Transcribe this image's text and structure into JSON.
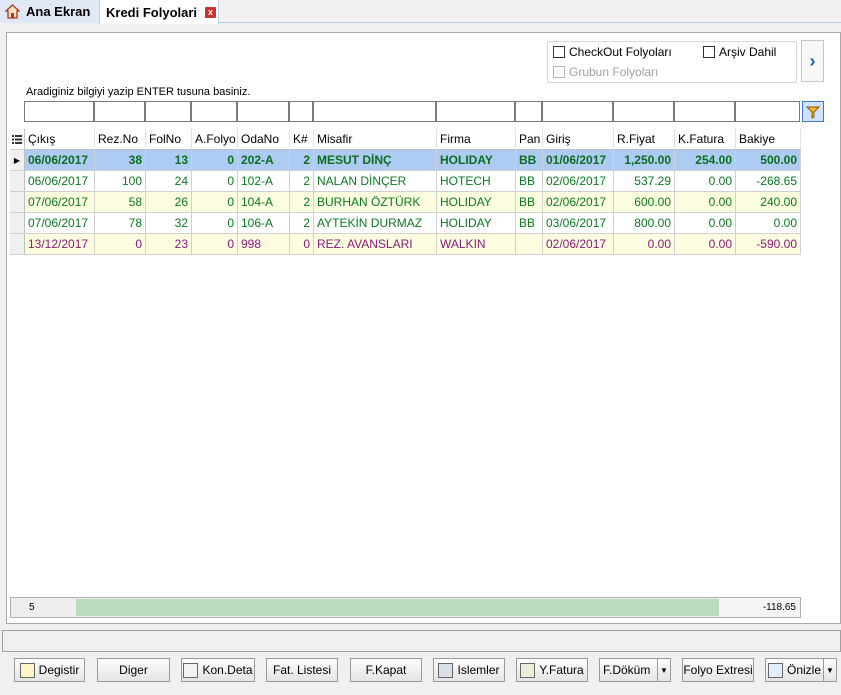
{
  "tabs": {
    "home": "Ana Ekran",
    "active": "Kredi Folyolari",
    "close": "x"
  },
  "options": {
    "checkout": "CheckOut Folyoları",
    "arsiv": "Arşiv Dahil",
    "grubun": "Grubun Folyoları",
    "next": "›"
  },
  "search_label": "Aradiginiz bilgiyi yazip ENTER tusuna basiniz.",
  "grid": {
    "columns": [
      "Çıkış",
      "Rez.No",
      "FolNo",
      "A.Folyo",
      "OdaNo",
      "K#",
      "Misafir",
      "Firma",
      "Pan",
      "Giriş",
      "R.Fiyat",
      "K.Fatura",
      "Bakiye"
    ],
    "rows": [
      [
        "06/06/2017",
        "38",
        "13",
        "0",
        "202-A",
        "2",
        "MESUT DİNÇ",
        "HOLIDAY",
        "BB",
        "01/06/2017",
        "1,250.00",
        "254.00",
        "500.00"
      ],
      [
        "06/06/2017",
        "100",
        "24",
        "0",
        "102-A",
        "2",
        "NALAN DİNÇER",
        "HOTECH",
        "BB",
        "02/06/2017",
        "537.29",
        "0.00",
        "-268.65"
      ],
      [
        "07/06/2017",
        "58",
        "26",
        "0",
        "104-A",
        "2",
        "BURHAN ÖZTÜRK",
        "HOLIDAY",
        "BB",
        "02/06/2017",
        "600.00",
        "0.00",
        "240.00"
      ],
      [
        "07/06/2017",
        "78",
        "32",
        "0",
        "106-A",
        "2",
        "AYTEKİN DURMAZ",
        "HOLIDAY",
        "BB",
        "03/06/2017",
        "800.00",
        "0.00",
        "0.00"
      ],
      [
        "13/12/2017",
        "0",
        "23",
        "0",
        "998",
        "0",
        "REZ. AVANSLARI",
        "WALKIN",
        "",
        "02/06/2017",
        "0.00",
        "0.00",
        "-590.00"
      ]
    ],
    "row_styles": [
      "row-sel",
      "row-g",
      "row-y",
      "row-g",
      "row-p"
    ],
    "row_backgrounds": [
      "#aecbf3",
      "#ffffff",
      "#fdfde0",
      "#ffffff",
      "#fdfde0"
    ]
  },
  "summary": {
    "count": "5",
    "total": "-118.65"
  },
  "buttons": {
    "degistir": "Degistir",
    "diger": "Diger",
    "kondeta": "Kon.Deta",
    "fatlistesi": "Fat. Listesi",
    "fkapat": "F.Kapat",
    "islemler": "Islemler",
    "yfatura": "Y.Fatura",
    "fdokum": "F.Döküm",
    "folyoextresi": "Folyo Extresi",
    "onizle": "Önizle"
  },
  "colors": {
    "selected_row": "#aecbf3",
    "green_text": "#0a7a1e",
    "purple_text": "#8b1a7a",
    "summary_bar": "#b8dcbc"
  }
}
